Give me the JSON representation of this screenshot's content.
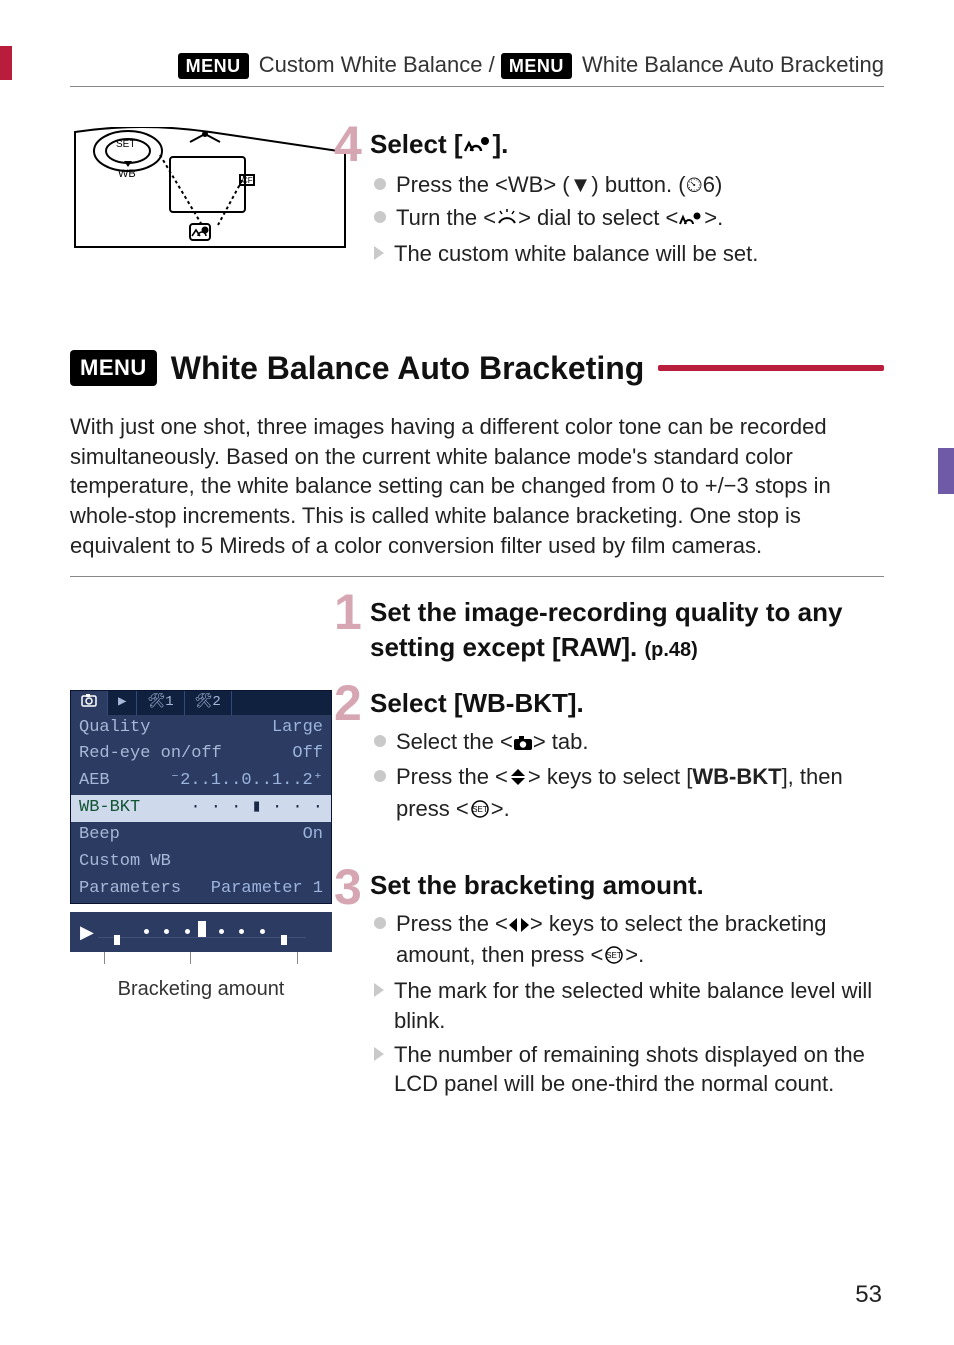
{
  "header": {
    "menu_label": "MENU",
    "text1": " Custom White Balance / ",
    "text2": " White Balance Auto Bracketing"
  },
  "step4": {
    "title_prefix": "Select  [",
    "title_icon_name": "custom-wb-icon",
    "title_suffix": "].",
    "b1_pre": "Press the <",
    "b1_wb": "WB",
    "b1_mid": "> (",
    "b1_down": "▼",
    "b1_post": ") button. (",
    "b1_timer": "⏲6",
    "b1_end": ")",
    "b2_pre": "Turn the <",
    "b2_mid": "> dial to select <",
    "b2_end": ">.",
    "b3": "The custom white balance will be set."
  },
  "section": {
    "menu_label": "MENU",
    "title": "White Balance Auto Bracketing"
  },
  "intro": "With just one shot, three images having a different color tone can be recorded simultaneously. Based on the current white balance mode's standard color temperature, the white balance setting can be changed from 0 to +/−3 stops in whole-stop increments. This is called white balance bracketing. One stop is equivalent to 5 Mireds of a color conversion filter used by film cameras.",
  "step1": {
    "title": "Set the image-recording quality to any setting except [RAW]. ",
    "pageref": "(p.48)"
  },
  "step2": {
    "title": "Select [WB-BKT].",
    "b1_pre": "Select the <",
    "b1_post": "> tab.",
    "b2_pre": "Press the <",
    "b2_post": "> keys to select [",
    "b2_bold": "WB-BKT",
    "b2_mid2": "], then press <",
    "b2_end": ">."
  },
  "lcd": {
    "tabs": [
      "📷",
      "▶",
      "🛠1",
      "🛠2"
    ],
    "rows": [
      {
        "k": "Quality",
        "v": "Large"
      },
      {
        "k": "Red-eye on/off",
        "v": "Off"
      },
      {
        "k": "AEB",
        "v": "⁻2..1..0..1..2⁺"
      },
      {
        "k": "WB-BKT",
        "v": "· · · ▮ · · ·",
        "sel": true
      },
      {
        "k": "Beep",
        "v": "On"
      },
      {
        "k": "Custom WB",
        "v": ""
      },
      {
        "k": "Parameters",
        "v": "Parameter 1"
      }
    ]
  },
  "bkt_caption": "Bracketing amount",
  "step3": {
    "title": "Set the bracketing amount.",
    "b1_pre": "Press the <",
    "b1_mid": "> keys to select the bracketing amount, then press <",
    "b1_end": ">.",
    "b2": "The mark for the selected white balance level will blink.",
    "b3": "The number of remaining shots displayed on the LCD panel will be one-third the normal count."
  },
  "page_number": "53"
}
